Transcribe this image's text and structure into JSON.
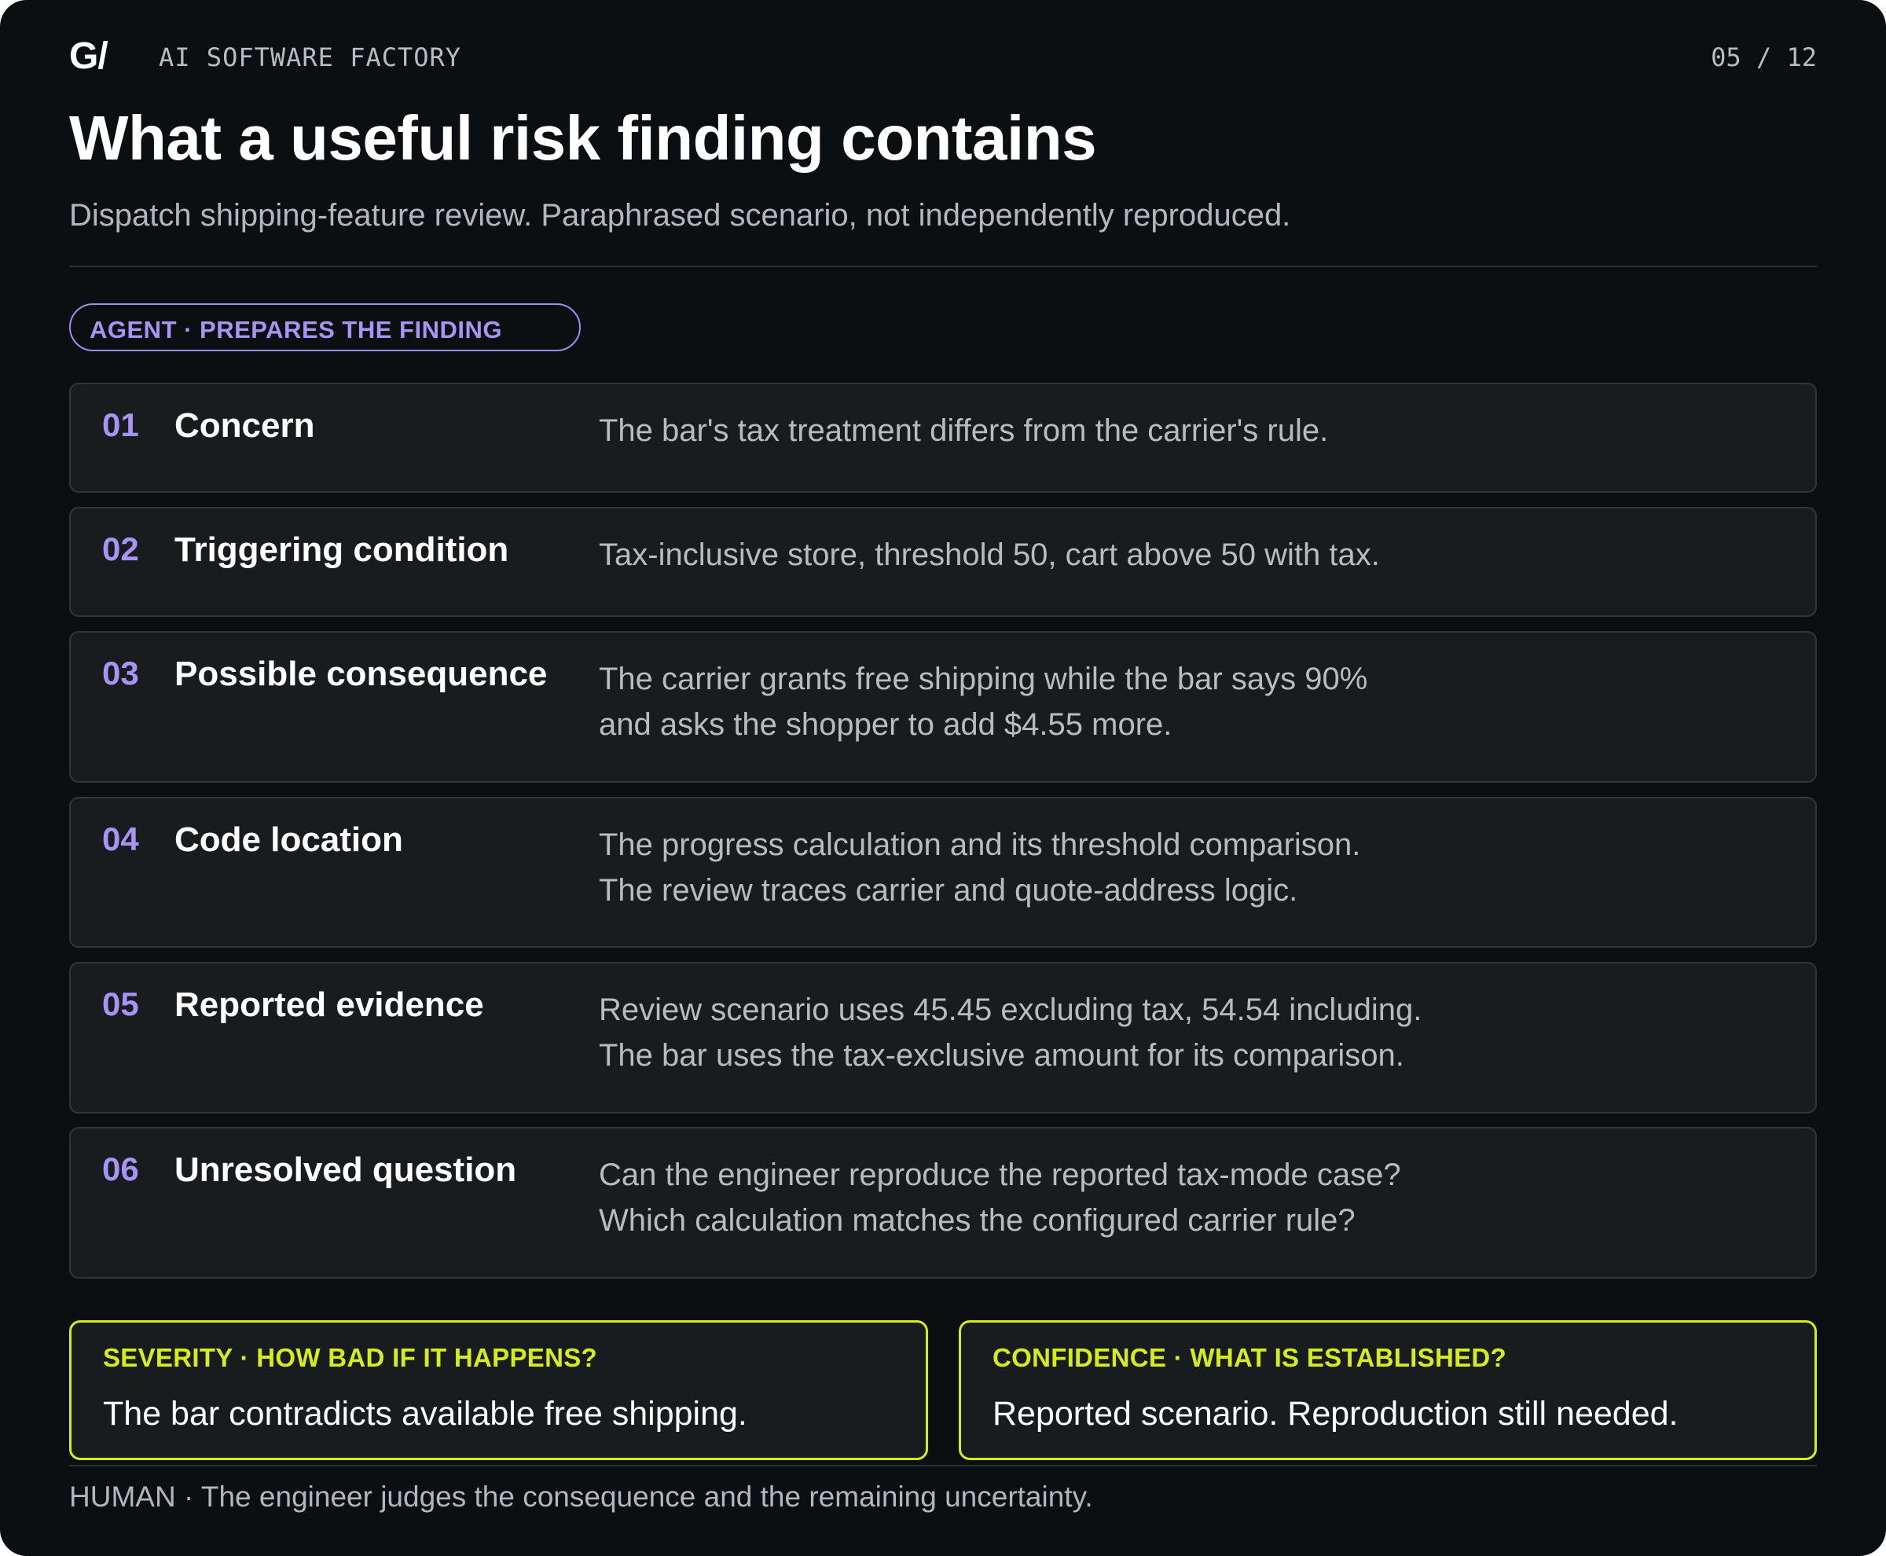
{
  "header": {
    "logo": "G/",
    "brand": "AI SOFTWARE FACTORY",
    "page": "05 / 12"
  },
  "title": "What a useful risk finding contains",
  "subtitle": "Dispatch shipping-feature review. Paraphrased scenario, not independently reproduced.",
  "agent_pill": "AGENT · PREPARES THE FINDING",
  "rows": [
    {
      "num": "01",
      "label": "Concern",
      "lines": [
        "The bar's tax treatment differs from the carrier's rule."
      ]
    },
    {
      "num": "02",
      "label": "Triggering condition",
      "lines": [
        "Tax-inclusive store, threshold 50, cart above 50 with tax."
      ]
    },
    {
      "num": "03",
      "label": "Possible consequence",
      "lines": [
        "The carrier grants free shipping while the bar says 90%",
        "and asks the shopper to add $4.55 more."
      ]
    },
    {
      "num": "04",
      "label": "Code location",
      "lines": [
        "The progress calculation and its threshold comparison.",
        "The review traces carrier and quote-address logic."
      ]
    },
    {
      "num": "05",
      "label": "Reported evidence",
      "lines": [
        "Review scenario uses 45.45 excluding tax, 54.54 including.",
        "The bar uses the tax-exclusive amount for its comparison."
      ]
    },
    {
      "num": "06",
      "label": "Unresolved question",
      "lines": [
        "Can the engineer reproduce the reported tax-mode case?",
        "Which calculation matches the configured carrier rule?"
      ]
    }
  ],
  "severity": {
    "title": "SEVERITY · HOW BAD IF IT HAPPENS?",
    "body": "The bar contradicts available free shipping."
  },
  "confidence": {
    "title": "CONFIDENCE · WHAT IS ESTABLISHED?",
    "body": "Reported scenario. Reproduction still needed."
  },
  "footer": "HUMAN · The engineer judges the consequence and the remaining uncertainty.",
  "colors": {
    "background": "#0c0f11",
    "accent_purple": "#a894f5",
    "accent_yellow": "#d6ed1c"
  }
}
